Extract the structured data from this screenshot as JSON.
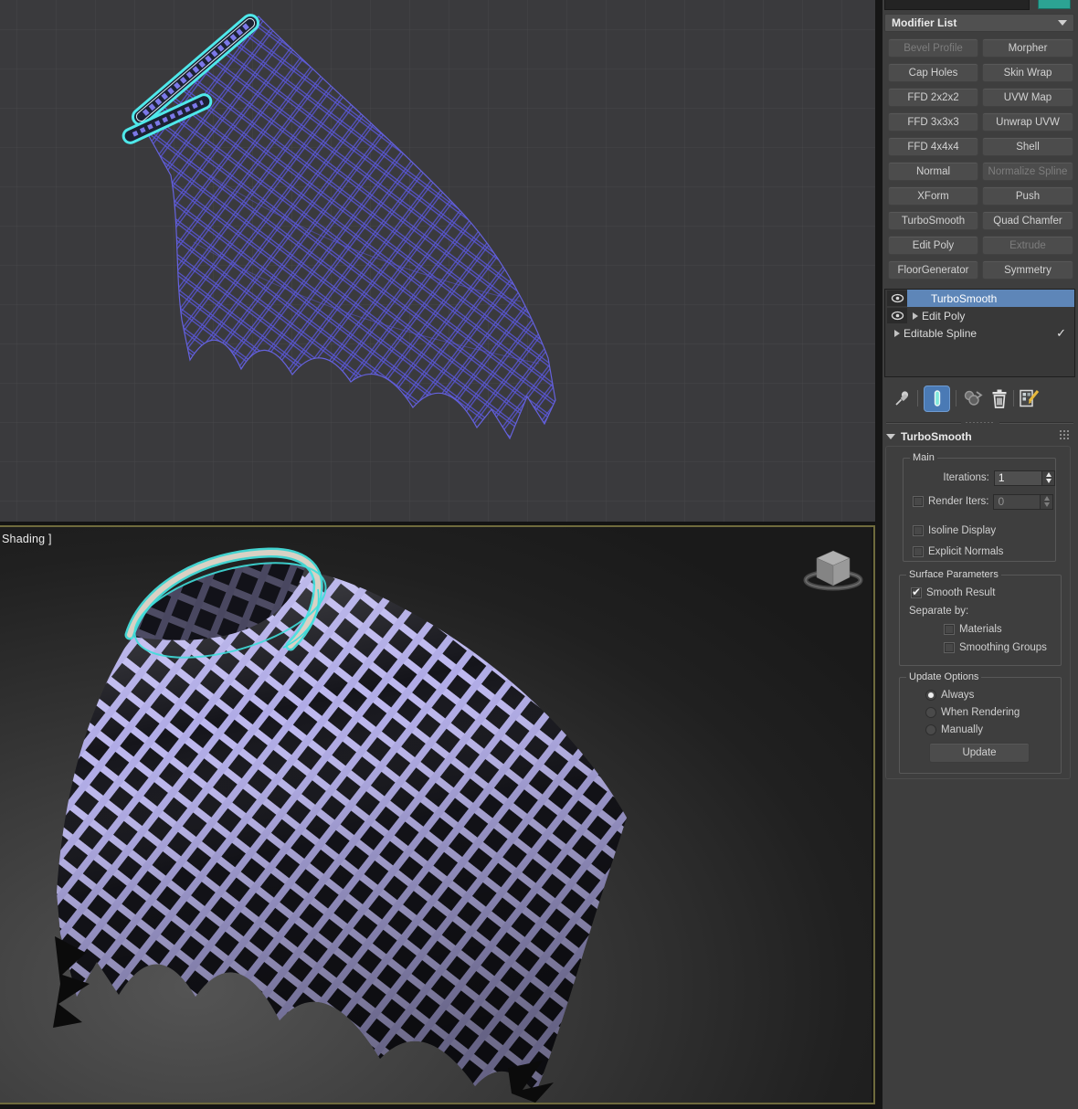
{
  "viewport": {
    "bottom": {
      "shading_label": "Shading ]"
    },
    "colors": {
      "top_background": "#3a3a3d",
      "grid_line": "#474749",
      "wireframe": "#5956d8",
      "selected_spline": "#46e3df",
      "lattice": "#bdb8ee",
      "tube": "#d9d1c4",
      "active_viewport_border": "#6f6b3d"
    }
  },
  "panel": {
    "modifier_list_label": "Modifier List",
    "object_color": "#2ca393",
    "modifier_buttons": [
      {
        "label": "Bevel Profile",
        "enabled": false
      },
      {
        "label": "Morpher",
        "enabled": true
      },
      {
        "label": "Cap Holes",
        "enabled": true
      },
      {
        "label": "Skin Wrap",
        "enabled": true
      },
      {
        "label": "FFD 2x2x2",
        "enabled": true
      },
      {
        "label": "UVW Map",
        "enabled": true
      },
      {
        "label": "FFD 3x3x3",
        "enabled": true
      },
      {
        "label": "Unwrap UVW",
        "enabled": true
      },
      {
        "label": "FFD 4x4x4",
        "enabled": true
      },
      {
        "label": "Shell",
        "enabled": true
      },
      {
        "label": "Normal",
        "enabled": true
      },
      {
        "label": "Normalize Spline",
        "enabled": false
      },
      {
        "label": "XForm",
        "enabled": true
      },
      {
        "label": "Push",
        "enabled": true
      },
      {
        "label": "TurboSmooth",
        "enabled": true
      },
      {
        "label": "Quad Chamfer",
        "enabled": true
      },
      {
        "label": "Edit Poly",
        "enabled": true
      },
      {
        "label": "Extrude",
        "enabled": false
      },
      {
        "label": "FloorGenerator",
        "enabled": true
      },
      {
        "label": "Symmetry",
        "enabled": true
      }
    ],
    "stack": {
      "items": [
        {
          "name": "TurboSmooth",
          "selected": true,
          "eye": true
        },
        {
          "name": "Edit Poly",
          "selected": false,
          "eye": true
        },
        {
          "name": "Editable Spline",
          "selected": false,
          "eye": false,
          "check": true
        }
      ],
      "selection_color": "#5e86b8"
    },
    "toolbar": {
      "icons": [
        "pin-icon",
        "show-end-result-icon",
        "make-unique-icon",
        "remove-modifier-icon",
        "configure-modifier-sets-icon"
      ]
    },
    "rollout": {
      "title": "TurboSmooth",
      "main": {
        "label": "Main",
        "iterations_label": "Iterations:",
        "iterations_value": "1",
        "render_iters_label": "Render Iters:",
        "render_iters_value": "0",
        "isoline_label": "Isoline Display",
        "explicit_label": "Explicit Normals"
      },
      "surface": {
        "label": "Surface Parameters",
        "smooth_result": "Smooth Result",
        "separate_by": "Separate by:",
        "materials": "Materials",
        "smoothing_groups": "Smoothing Groups"
      },
      "update": {
        "label": "Update Options",
        "always": "Always",
        "when_rendering": "When Rendering",
        "manually": "Manually",
        "update_button": "Update"
      }
    }
  }
}
